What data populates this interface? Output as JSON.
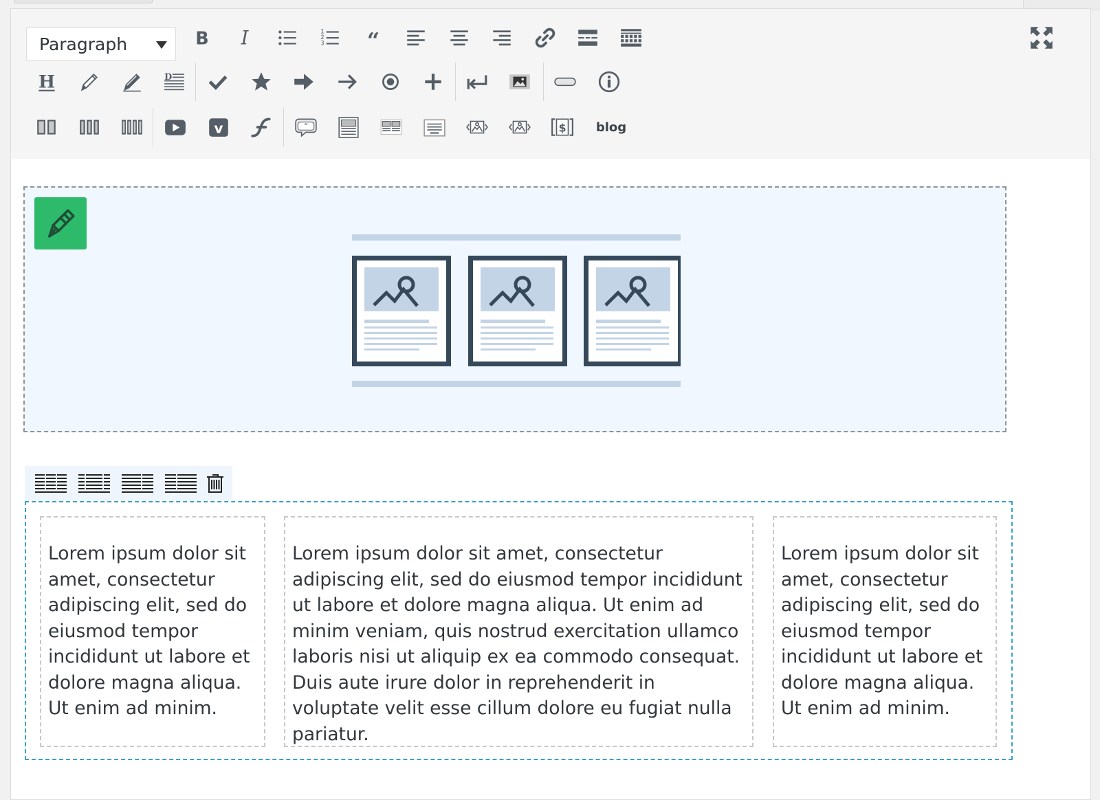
{
  "toolbar": {
    "format_select": {
      "value": "Paragraph"
    },
    "row1_buttons": [
      {
        "icon": "bold-icon"
      },
      {
        "icon": "italic-icon"
      },
      {
        "icon": "bullet-list-icon"
      },
      {
        "icon": "numbered-list-icon"
      },
      {
        "icon": "blockquote-icon"
      },
      {
        "icon": "align-left-icon"
      },
      {
        "icon": "align-center-icon"
      },
      {
        "icon": "align-right-icon"
      },
      {
        "icon": "link-icon"
      },
      {
        "icon": "read-more-icon"
      },
      {
        "icon": "toolbar-toggle-icon"
      }
    ],
    "row2_buttons": [
      {
        "icon": "heading-icon"
      },
      {
        "icon": "pencil-icon"
      },
      {
        "icon": "pencil-alt-icon"
      },
      {
        "icon": "dropcap-icon"
      },
      {
        "icon": "checkmark-icon"
      },
      {
        "icon": "star-icon"
      },
      {
        "icon": "arrow-bold-icon"
      },
      {
        "icon": "arrow-thin-icon"
      },
      {
        "icon": "radio-dot-icon"
      },
      {
        "icon": "plus-icon"
      },
      {
        "icon": "return-icon"
      },
      {
        "icon": "image-icon"
      },
      {
        "icon": "button-shape-icon"
      },
      {
        "icon": "info-icon"
      }
    ],
    "row3_buttons": [
      {
        "icon": "two-columns-icon"
      },
      {
        "icon": "three-columns-icon"
      },
      {
        "icon": "four-columns-icon"
      },
      {
        "icon": "youtube-icon"
      },
      {
        "icon": "vimeo-icon"
      },
      {
        "icon": "flash-icon"
      },
      {
        "icon": "testimonial-icon"
      },
      {
        "icon": "layout-stacked-icon"
      },
      {
        "icon": "layout-grid-icon"
      },
      {
        "icon": "layout-text-icon"
      },
      {
        "icon": "carousel-icon"
      },
      {
        "icon": "carousel-alt-icon"
      },
      {
        "icon": "pricing-icon"
      }
    ],
    "blog_label": "blog",
    "fullscreen_icon": "fullscreen-icon"
  },
  "placeholder": {
    "edit_icon": "edit-pencil-icon",
    "badge_color": "#2dbb6b",
    "illustration": "gallery-placeholder-icon"
  },
  "row_toolbar": {
    "buttons": [
      {
        "icon": "layout-equal-columns-icon"
      },
      {
        "icon": "layout-wide-center-icon"
      },
      {
        "icon": "layout-wide-left-icon"
      },
      {
        "icon": "layout-wide-right-icon"
      },
      {
        "icon": "trash-icon"
      }
    ]
  },
  "columns": [
    {
      "text": "Lorem ipsum dolor sit amet, consectetur adipiscing elit, sed do eiusmod tempor incididunt ut labore et dolore magna aliqua. Ut enim ad minim."
    },
    {
      "text": "Lorem ipsum dolor sit amet, consectetur adipiscing elit, sed do eiusmod tempor incididunt ut labore et dolore magna aliqua. Ut enim ad minim veniam, quis nostrud exercitation ullamco laboris nisi ut aliquip ex ea commodo consequat. Duis aute irure dolor in reprehenderit in voluptate velit esse cillum dolore eu fugiat nulla pariatur."
    },
    {
      "text": "Lorem ipsum dolor sit amet, consectetur adipiscing elit, sed do eiusmod tempor incididunt ut labore et dolore magna aliqua. Ut enim ad minim."
    }
  ]
}
